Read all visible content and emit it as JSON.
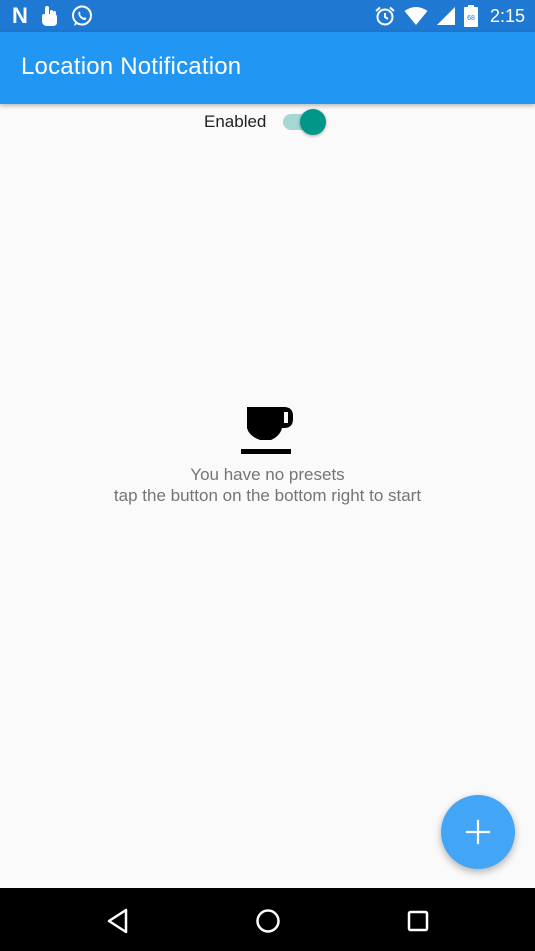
{
  "status_bar": {
    "time": "2:15",
    "left_icons": [
      "netflix-icon",
      "touch-icon",
      "whatsapp-icon"
    ],
    "right_icons": [
      "alarm-icon",
      "wifi-icon",
      "signal-icon",
      "battery-icon"
    ],
    "netflix_letter": "N",
    "battery_level_text": "68",
    "background_color": "#1f78d1"
  },
  "app_bar": {
    "title": "Location Notification",
    "background_color": "#2196f3"
  },
  "toggle": {
    "label": "Enabled",
    "checked": true,
    "thumb_color": "#009688",
    "track_color": "#a6d7d2"
  },
  "empty_state": {
    "icon": "coffee-cup-icon",
    "line1": "You have no presets",
    "line2": "tap the button on the bottom right to start"
  },
  "fab": {
    "icon": "plus-icon",
    "color": "#42a5f5"
  },
  "nav_bar": {
    "buttons": [
      "back-icon",
      "home-icon",
      "recents-icon"
    ]
  }
}
